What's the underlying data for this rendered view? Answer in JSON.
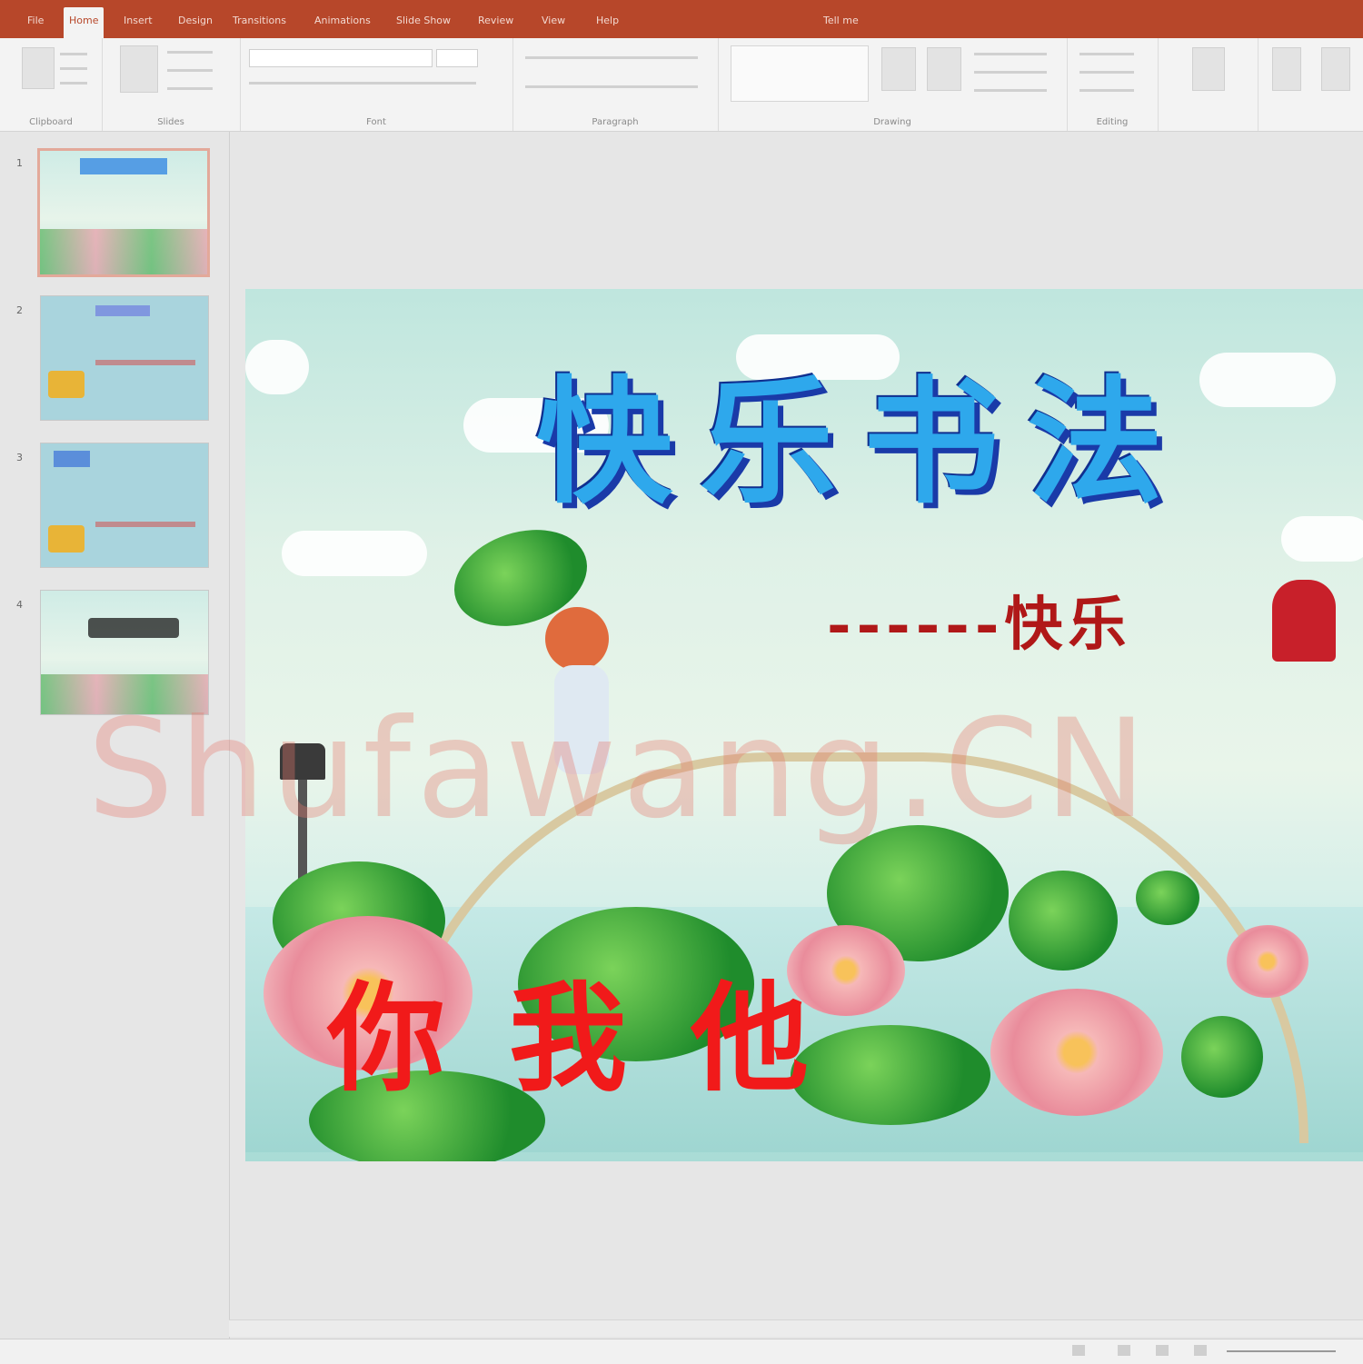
{
  "ribbon_tabs": [
    "File",
    "Home",
    "Insert",
    "Design",
    "Transitions",
    "Animations",
    "Slide Show",
    "Review",
    "View",
    "Help",
    "Tell me"
  ],
  "ribbon_active_tab": "Home",
  "ribbon_groups": [
    "Clipboard",
    "Slides",
    "Font",
    "Paragraph",
    "Drawing",
    "Editing"
  ],
  "slide_thumbnails": [
    {
      "number": "1",
      "selected": true
    },
    {
      "number": "2",
      "selected": false
    },
    {
      "number": "3",
      "selected": false
    },
    {
      "number": "4",
      "selected": false
    }
  ],
  "slide": {
    "title": "快乐书法",
    "subtitle": "------快乐",
    "names": "你我他",
    "watermark": "Shufawang.CN"
  },
  "colors": {
    "ribbon_accent": "#b7472a",
    "title_fill": "#2ea8ec",
    "title_shadow": "#1a3aa8",
    "subtitle": "#b01818",
    "names": "#f11a1a"
  },
  "icons": {
    "normal_view": "normal-view-icon",
    "sorter_view": "slide-sorter-icon",
    "reading_view": "reading-view-icon",
    "slideshow": "slideshow-icon"
  }
}
